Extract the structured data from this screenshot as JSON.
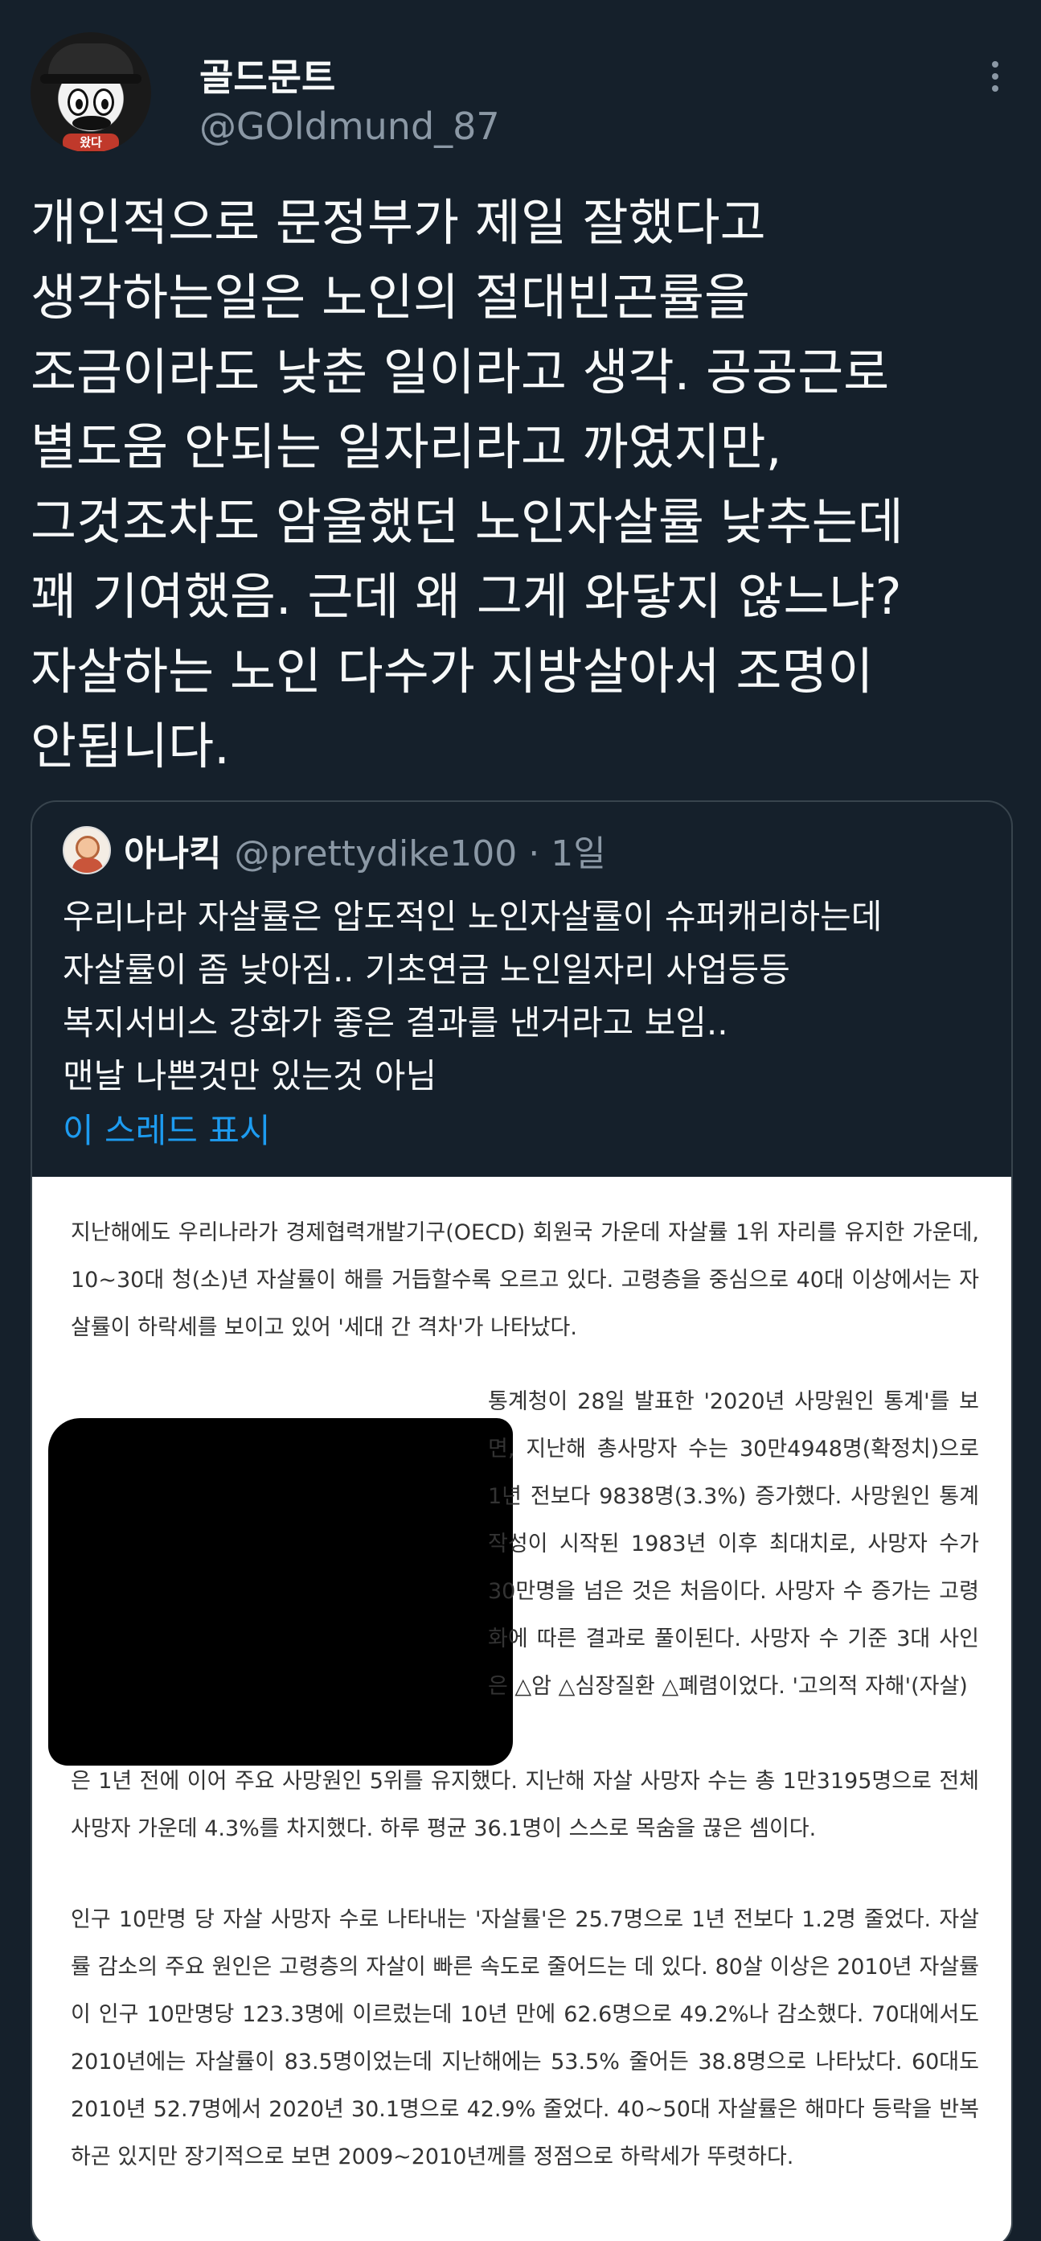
{
  "tweet": {
    "display_name": "골드문트",
    "handle": "@GOldmund_87",
    "avatar_badge": "왔다",
    "text": "개인적으로 문정부가 제일 잘했다고\n생각하는일은 노인의 절대빈곤률을\n조금이라도 낮춘 일이라고 생각. 공공근로\n별도움 안되는 일자리라고 까였지만,\n그것조차도 암울했던 노인자살률 낮추는데\n꽤 기여했음. 근데 왜 그게 와닿지 않느냐?\n자살하는 노인 다수가 지방살아서 조명이\n안됩니다."
  },
  "quote": {
    "display_name": "아나킥",
    "handle_time": "@prettydike100 · 1일",
    "text": "우리나라 자살률은 압도적인 노인자살률이 슈퍼캐리하는데\n자살률이 좀 낮아짐.. 기초연금 노인일자리 사업등등\n복지서비스 강화가 좋은 결과를 낸거라고 보임..\n맨날 나쁜것만 있는것 아님",
    "show_thread_label": "이 스레드 표시"
  },
  "article": {
    "paragraph1": "지난해에도 우리나라가 경제협력개발기구(OECD) 회원국 가운데 자살률 1위 자리를 유지한 가운데, 10~30대 청(소)년 자살률이 해를 거듭할수록 오르고 있다. 고령층을 중심으로 40대 이상에서는 자살률이 하락세를 보이고 있어 '세대 간 격차'가 나타났다.",
    "paragraph2_wrap": "통계청이 28일 발표한 '2020년 사망원인 통계'를 보면, 지난해 총사망자 수는 30만4948명(확정치)으로 1년 전보다 9838명(3.3%) 증가했다. 사망원인 통계 작성이 시작된 1983년 이후 최대치로, 사망자 수가 30만명을 넘은 것은 처음이다. 사망자 수 증가는 고령화에 따른 결과로 풀이된다. 사망자 수 기준 3대 사인은 △암 △심장질환 △폐렴이었다. '고의적 자해'(자살)",
    "paragraph2_cont": "은 1년 전에 이어 주요 사망원인 5위를 유지했다. 지난해 자살 사망자 수는 총 1만3195명으로 전체 사망자 가운데 4.3%를 차지했다. 하루 평균 36.1명이 스스로 목숨을 끊은 셈이다.",
    "paragraph3": "인구 10만명 당 자살 사망자 수로 나타내는 '자살률'은 25.7명으로 1년 전보다 1.2명 줄었다. 자살률 감소의 주요 원인은 고령층의 자살이 빠른 속도로 줄어드는 데 있다. 80살 이상은 2010년 자살률이 인구 10만명당 123.3명에 이르렀는데 10년 만에 62.6명으로 49.2%나 감소했다. 70대에서도 2010년에는 자살률이 83.5명이었는데 지난해에는 53.5% 줄어든 38.8명으로 나타났다. 60대도 2010년 52.7명에서 2020년 30.1명으로 42.9% 줄었다. 40~50대 자살률은 해마다 등락을 반복하곤 있지만 장기적으로 보면 2009~2010년께를 정점으로 하락세가 뚜렷하다."
  }
}
